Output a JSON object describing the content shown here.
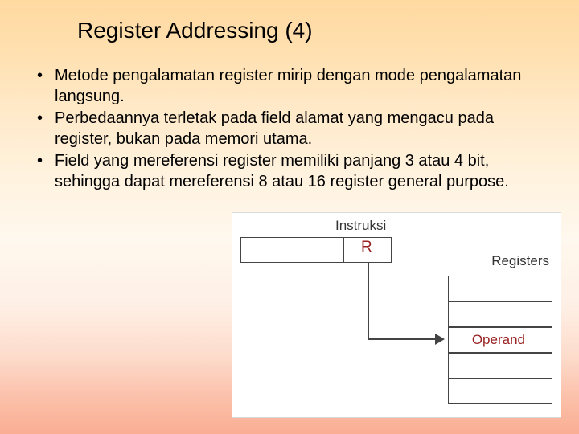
{
  "title": "Register Addressing (4)",
  "bullets": [
    "Metode pengalamatan register mirip dengan mode pengalamatan langsung.",
    "Perbedaannya terletak pada field alamat yang mengacu pada register, bukan pada memori utama.",
    "Field yang mereferensi register memiliki panjang 3 atau 4 bit, sehingga dapat mereferensi 8 atau 16 register general purpose."
  ],
  "diagram": {
    "instr_label": "Instruksi",
    "field_label": "R",
    "registers_label": "Registers",
    "operand_label": "Operand"
  }
}
